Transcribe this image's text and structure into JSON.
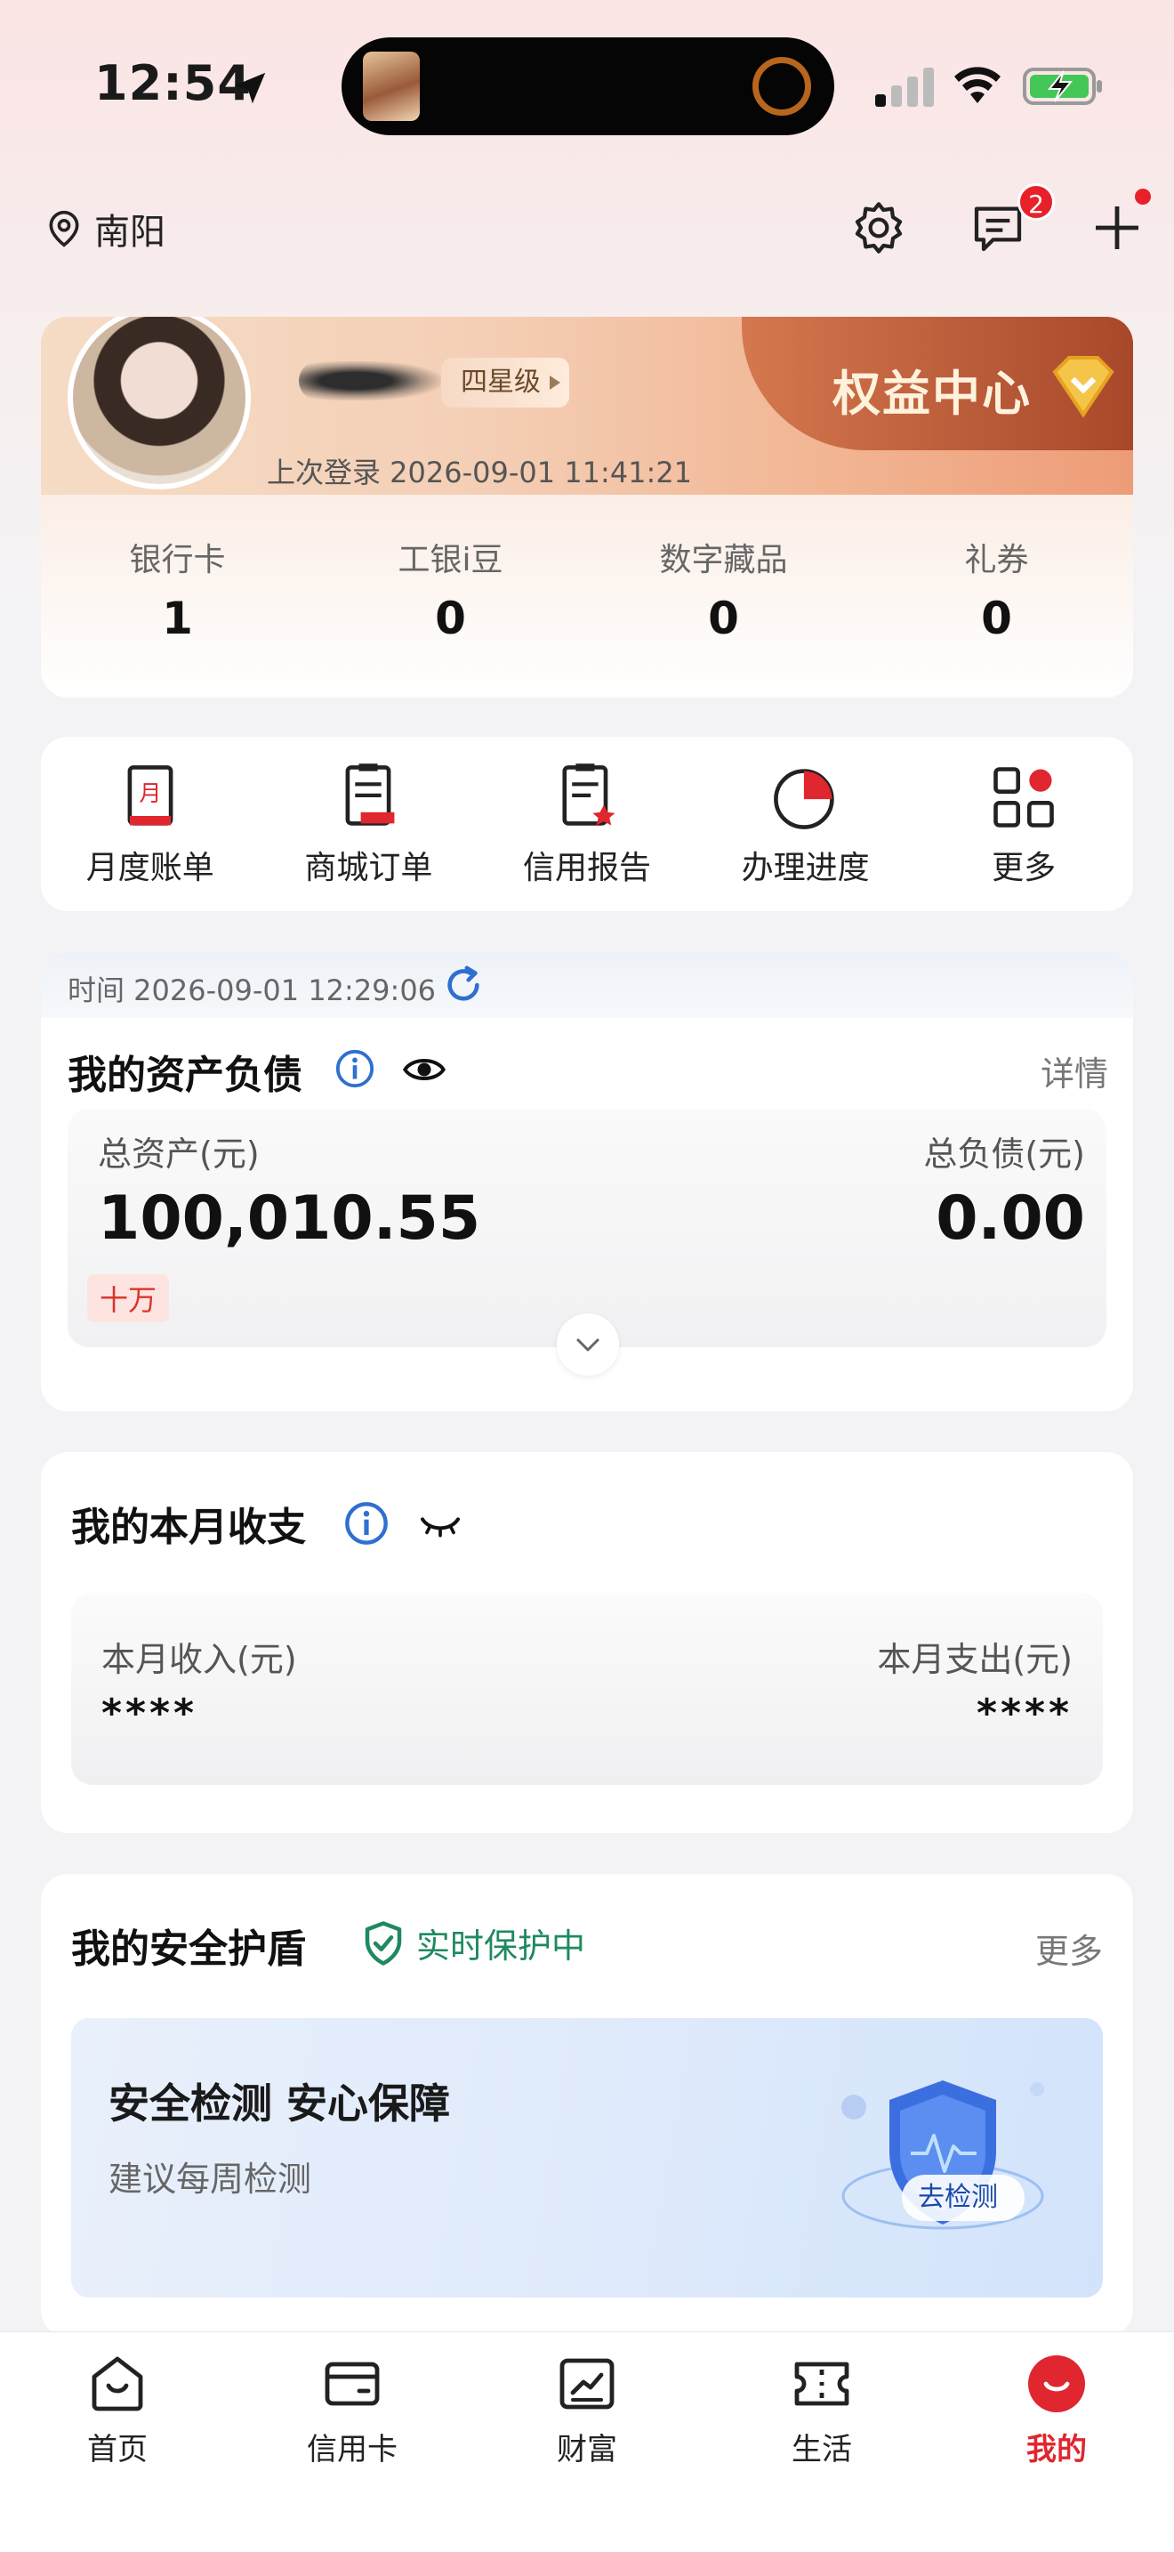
{
  "status_bar": {
    "time": "12:54"
  },
  "topnav": {
    "city": "南阳",
    "message_badge": "2"
  },
  "profile": {
    "level": "四星级",
    "rights_center": "权益中心",
    "last_login": "上次登录 2026-09-01 11:41:21",
    "stats": [
      {
        "label": "银行卡",
        "value": "1"
      },
      {
        "label": "工银i豆",
        "value": "0"
      },
      {
        "label": "数字藏品",
        "value": "0"
      },
      {
        "label": "礼券",
        "value": "0"
      }
    ]
  },
  "quick_actions": [
    {
      "label": "月度账单",
      "icon": "monthly-bill-icon"
    },
    {
      "label": "商城订单",
      "icon": "mall-order-icon"
    },
    {
      "label": "信用报告",
      "icon": "credit-report-icon"
    },
    {
      "label": "办理进度",
      "icon": "progress-icon"
    },
    {
      "label": "更多",
      "icon": "more-grid-icon"
    }
  ],
  "assets": {
    "time": "时间 2026-09-01 12:29:06",
    "title": "我的资产负债",
    "detail": "详情",
    "total_assets_label": "总资产(元)",
    "total_assets_value": "100,010.55",
    "unit_tag": "十万",
    "total_debt_label": "总负债(元)",
    "total_debt_value": "0.00"
  },
  "income": {
    "title": "我的本月收支",
    "income_label": "本月收入(元)",
    "income_value": "****",
    "expense_label": "本月支出(元)",
    "expense_value": "****"
  },
  "security": {
    "title": "我的安全护盾",
    "status": "实时保护中",
    "more": "更多",
    "banner_title": "安全检测 安心保障",
    "banner_sub": "建议每周检测",
    "detect_button": "去检测"
  },
  "tabbar": [
    {
      "label": "首页",
      "icon": "home-icon"
    },
    {
      "label": "信用卡",
      "icon": "credit-card-icon"
    },
    {
      "label": "财富",
      "icon": "wealth-icon"
    },
    {
      "label": "生活",
      "icon": "life-ticket-icon"
    },
    {
      "label": "我的",
      "icon": "mine-icon",
      "active": true
    }
  ],
  "colors": {
    "accent_red": "#e0262e",
    "protect_green": "#1f8a5e",
    "info_blue": "#2f6fd0"
  }
}
